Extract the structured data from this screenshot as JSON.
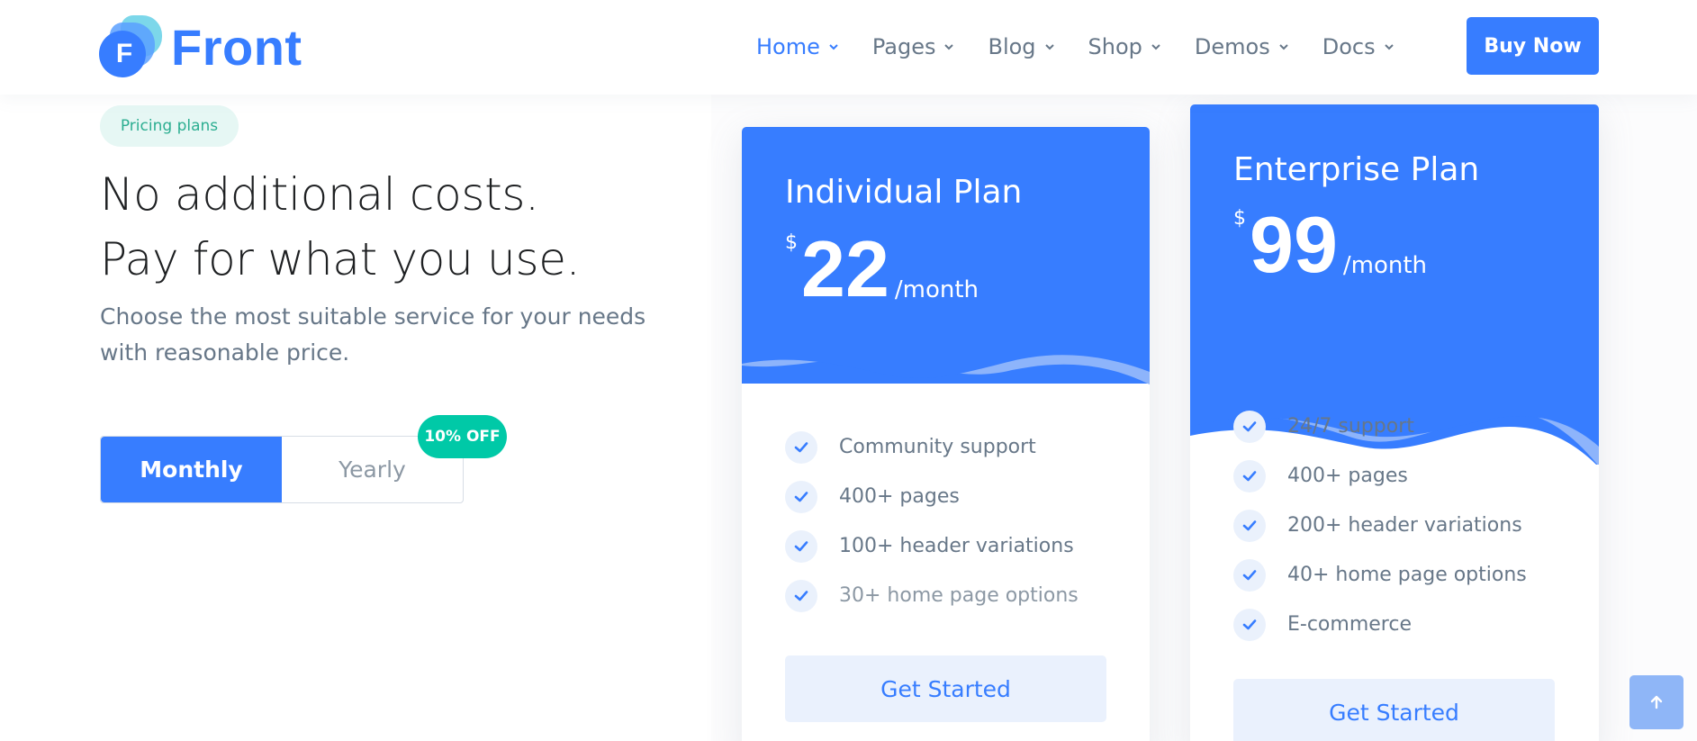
{
  "brand": {
    "name": "Front",
    "mark_letter": "F",
    "color": "#377dff"
  },
  "nav": {
    "items": [
      {
        "label": "Home",
        "active": true
      },
      {
        "label": "Pages"
      },
      {
        "label": "Blog"
      },
      {
        "label": "Shop"
      },
      {
        "label": "Demos"
      },
      {
        "label": "Docs"
      }
    ],
    "cta": "Buy Now"
  },
  "hero": {
    "badge": "Pricing plans",
    "title_line1": "No additional costs.",
    "title_line2": "Pay for what you use.",
    "lead": "Choose the most suitable service for your needs with reasonable price.",
    "toggle": {
      "monthly": "Monthly",
      "yearly": "Yearly",
      "selected": "Monthly"
    },
    "discount_badge": "10% OFF"
  },
  "plans": [
    {
      "name": "Individual Plan",
      "currency": "$",
      "price": "22",
      "period": "/month",
      "features": [
        "Community support",
        "400+ pages",
        "100+ header variations",
        "30+ home page options"
      ],
      "cta": "Get Started"
    },
    {
      "name": "Enterprise Plan",
      "currency": "$",
      "price": "99",
      "period": "/month",
      "features": [
        "24/7 support",
        "400+ pages",
        "200+ header variations",
        "40+ home page options",
        "E-commerce"
      ],
      "cta": "Get Started"
    }
  ],
  "icons": {
    "nav_chevron": "chevron-down-icon",
    "feature_check": "check-icon",
    "scroll_top": "arrow-up-icon"
  },
  "colors": {
    "primary": "#377dff",
    "success": "#00c9a7",
    "muted": "#677788"
  }
}
